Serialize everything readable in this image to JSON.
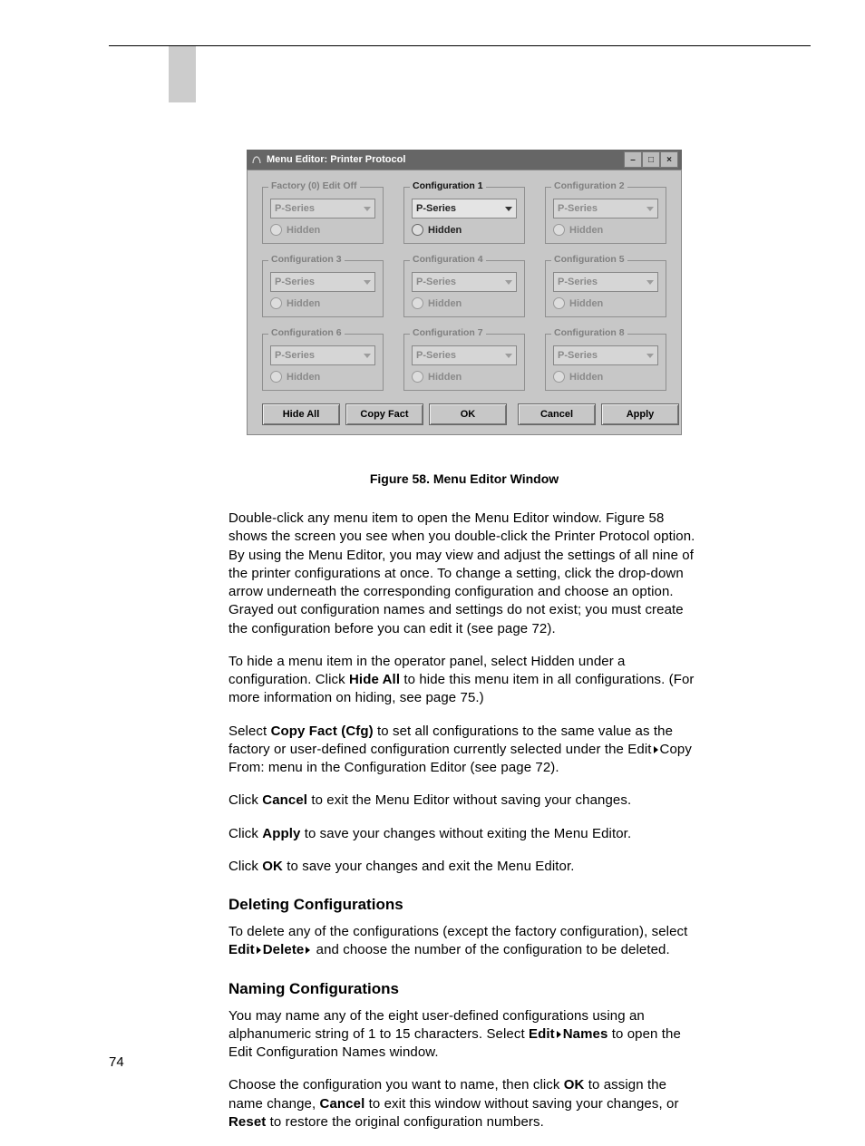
{
  "pageNumber": "74",
  "window": {
    "title": "Menu Editor: Printer Protocol",
    "groups": [
      {
        "legend": "Factory (0) Edit Off",
        "value": "P-Series",
        "hidden": "Hidden",
        "disabled": true
      },
      {
        "legend": "Configuration 1",
        "value": "P-Series",
        "hidden": "Hidden",
        "disabled": false
      },
      {
        "legend": "Configuration 2",
        "value": "P-Series",
        "hidden": "Hidden",
        "disabled": true
      },
      {
        "legend": "Configuration 3",
        "value": "P-Series",
        "hidden": "Hidden",
        "disabled": true
      },
      {
        "legend": "Configuration 4",
        "value": "P-Series",
        "hidden": "Hidden",
        "disabled": true
      },
      {
        "legend": "Configuration 5",
        "value": "P-Series",
        "hidden": "Hidden",
        "disabled": true
      },
      {
        "legend": "Configuration 6",
        "value": "P-Series",
        "hidden": "Hidden",
        "disabled": true
      },
      {
        "legend": "Configuration 7",
        "value": "P-Series",
        "hidden": "Hidden",
        "disabled": true
      },
      {
        "legend": "Configuration 8",
        "value": "P-Series",
        "hidden": "Hidden",
        "disabled": true
      }
    ],
    "buttons": {
      "hideAll": "Hide All",
      "copyFact": "Copy Fact",
      "ok": "OK",
      "cancel": "Cancel",
      "apply": "Apply"
    }
  },
  "caption": "Figure 58. Menu Editor Window",
  "para1": "Double-click any menu item to open the Menu Editor window. Figure 58 shows the screen you see when you double-click the Printer Protocol option. By using the Menu Editor, you may view and adjust the settings of all nine of the printer configurations at once. To change a setting, click the drop-down arrow underneath the corresponding configuration and choose an option. Grayed out configuration names and settings do not exist; you must create the configuration before you can edit it (see page 72).",
  "para2a": "To hide a menu item in the operator panel, select Hidden under a configuration. Click ",
  "para2bold": "Hide All",
  "para2b": " to hide this menu item in all configurations. (For more information on hiding, see page 75.)",
  "para3a": "Select ",
  "para3bold": "Copy Fact (Cfg)",
  "para3b": " to set all configurations to the same value as the factory or user-defined configuration currently selected under the Edit",
  "para3c": "Copy From: menu in the Configuration Editor (see page 72).",
  "para4a": "Click ",
  "para4bold": "Cancel",
  "para4b": " to exit the Menu Editor without saving your changes.",
  "para5a": "Click ",
  "para5bold": "Apply",
  "para5b": " to save your changes without exiting the Menu Editor.",
  "para6a": "Click ",
  "para6bold": "OK",
  "para6b": " to save your changes and exit the Menu Editor.",
  "h_delete": "Deleting Configurations",
  "para7a": "To delete any of the configurations (except the factory configuration), select ",
  "para7bold1": "Edit",
  "para7bold2": "Delete",
  "para7b": " and choose the number of the configuration to be deleted.",
  "h_name": "Naming Configurations",
  "para8a": "You may name any of the eight user-defined configurations using an alphanumeric string of 1 to 15 characters. Select ",
  "para8bold1": "Edit",
  "para8bold2": "Names",
  "para8b": " to open the Edit Configuration Names window.",
  "para9a": "Choose the configuration you want to name, then click ",
  "para9bold1": "OK",
  "para9b": " to assign the name change, ",
  "para9bold2": "Cancel",
  "para9c": " to exit this window without saving your changes, or ",
  "para9bold3": "Reset",
  "para9d": " to restore the original configuration numbers."
}
